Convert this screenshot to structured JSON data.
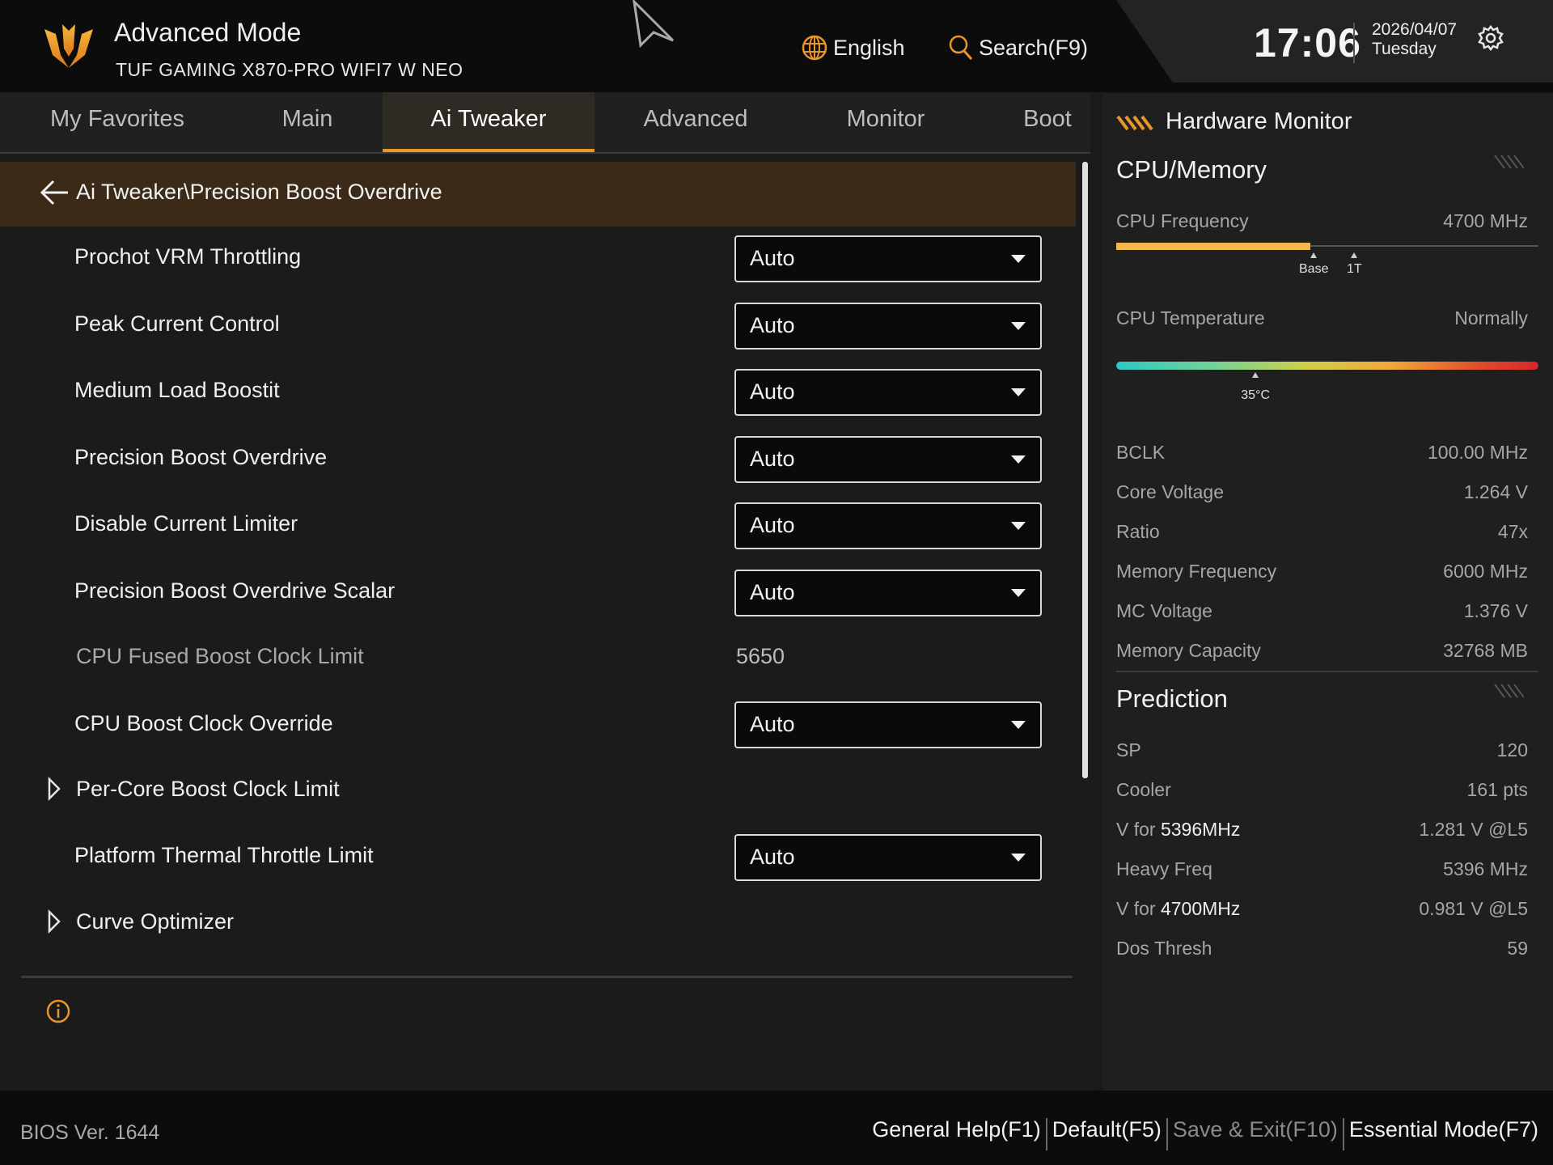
{
  "header": {
    "mode_title": "Advanced Mode",
    "model_name": "TUF GAMING X870-PRO WIFI7 W NEO",
    "language": "English",
    "search": "Search(F9)",
    "time": "17:06",
    "date": "2026/04/07",
    "weekday": "Tuesday"
  },
  "tabs": [
    "My Favorites",
    "Main",
    "Ai Tweaker",
    "Advanced",
    "Monitor",
    "Boot"
  ],
  "active_tab": "Ai Tweaker",
  "breadcrumb": "Ai Tweaker\\Precision Boost Overdrive",
  "settings": [
    {
      "label": "Prochot VRM Throttling",
      "value": "Auto"
    },
    {
      "label": "Peak Current Control",
      "value": "Auto"
    },
    {
      "label": "Medium Load Boostit",
      "value": "Auto"
    },
    {
      "label": "Precision Boost Overdrive",
      "value": "Auto"
    },
    {
      "label": "Disable Current Limiter",
      "value": "Auto"
    },
    {
      "label": "Precision Boost Overdrive Scalar",
      "value": "Auto"
    },
    {
      "label": "CPU Fused Boost Clock Limit",
      "value": "5650"
    },
    {
      "label": "CPU Boost Clock Override",
      "value": "Auto"
    },
    {
      "label": "Per-Core Boost Clock Limit"
    },
    {
      "label": "Platform Thermal Throttle Limit",
      "value": "Auto"
    },
    {
      "label": "Curve Optimizer"
    }
  ],
  "hw_monitor": {
    "title": "Hardware Monitor",
    "cpu_memory_title": "CPU/Memory",
    "cpu_frequency": {
      "label": "CPU Frequency",
      "value": "4700 MHz",
      "bar_fraction": 0.46,
      "base_label": "Base",
      "onet_label": "1T"
    },
    "cpu_temperature": {
      "label": "CPU Temperature",
      "status": "Normally",
      "reading": "35°C",
      "marker_fraction": 0.33
    },
    "stats": [
      {
        "label": "BCLK",
        "value": "100.00 MHz"
      },
      {
        "label": "Core Voltage",
        "value": "1.264 V"
      },
      {
        "label": "Ratio",
        "value": "47x"
      },
      {
        "label": "Memory Frequency",
        "value": "6000 MHz"
      },
      {
        "label": "MC Voltage",
        "value": "1.376 V"
      },
      {
        "label": "Memory Capacity",
        "value": "32768 MB"
      }
    ],
    "prediction_title": "Prediction",
    "prediction": [
      {
        "label": "SP",
        "value": "120"
      },
      {
        "label": "Cooler",
        "value": "161 pts"
      },
      {
        "label_prefix": "V for ",
        "label_bold": "5396MHz",
        "value": "1.281 V @L5"
      },
      {
        "label": "Heavy Freq",
        "value": "5396 MHz"
      },
      {
        "label_prefix": "V for ",
        "label_bold": "4700MHz",
        "value": "0.981 V @L5"
      },
      {
        "label": "Dos Thresh",
        "value": "59"
      }
    ]
  },
  "footer": {
    "bios_version": "BIOS Ver. 1644",
    "general_help": "General Help(F1)",
    "default": "Default(F5)",
    "save_exit": "Save & Exit(F10)",
    "essential_mode": "Essential Mode(F7)"
  },
  "colors": {
    "accent": "#e8962a",
    "breadcrumb_bg": "#3a2a17",
    "freq_bar": "#f0b84b"
  }
}
